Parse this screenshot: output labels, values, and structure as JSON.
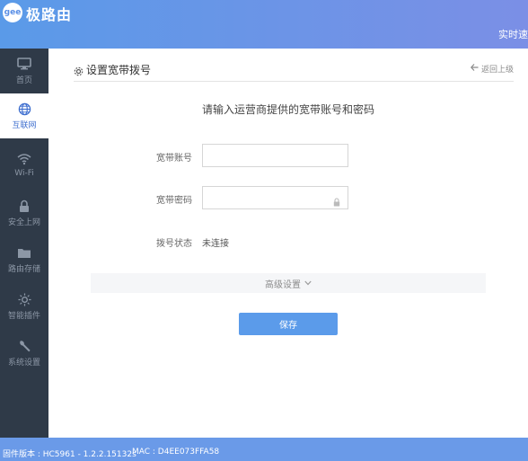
{
  "header": {
    "logo_text": "gee",
    "brand": "极路由",
    "realtime_text": "实时速"
  },
  "sidebar": {
    "items": [
      {
        "label": "首页",
        "icon": "monitor-icon"
      },
      {
        "label": "互联网",
        "icon": "globe-icon",
        "active": true
      },
      {
        "label": "Wi-Fi",
        "icon": "wifi-icon"
      },
      {
        "label": "安全上网",
        "icon": "lock-icon"
      },
      {
        "label": "路由存储",
        "icon": "folder-icon"
      },
      {
        "label": "智能插件",
        "icon": "sun-icon"
      },
      {
        "label": "系统设置",
        "icon": "wrench-icon"
      }
    ]
  },
  "main": {
    "title": "设置宽带拨号",
    "back_label": "返回上级",
    "prompt": "请输入运营商提供的宽带账号和密码",
    "account_label": "宽带账号",
    "account_value": "",
    "password_label": "宽带密码",
    "password_value": "",
    "status_label": "拨号状态",
    "status_value": "未连接",
    "advanced_label": "高级设置",
    "save_label": "保存"
  },
  "footer": {
    "firmware": "固件版本 : HC5961 - 1.2.2.15132s",
    "mac": "MAC : D4EE073FFA58"
  },
  "colors": {
    "header_start": "#5a9ae8",
    "header_end": "#7b8fe6",
    "sidebar_bg": "#2f3a48",
    "accent": "#5b9bea"
  }
}
